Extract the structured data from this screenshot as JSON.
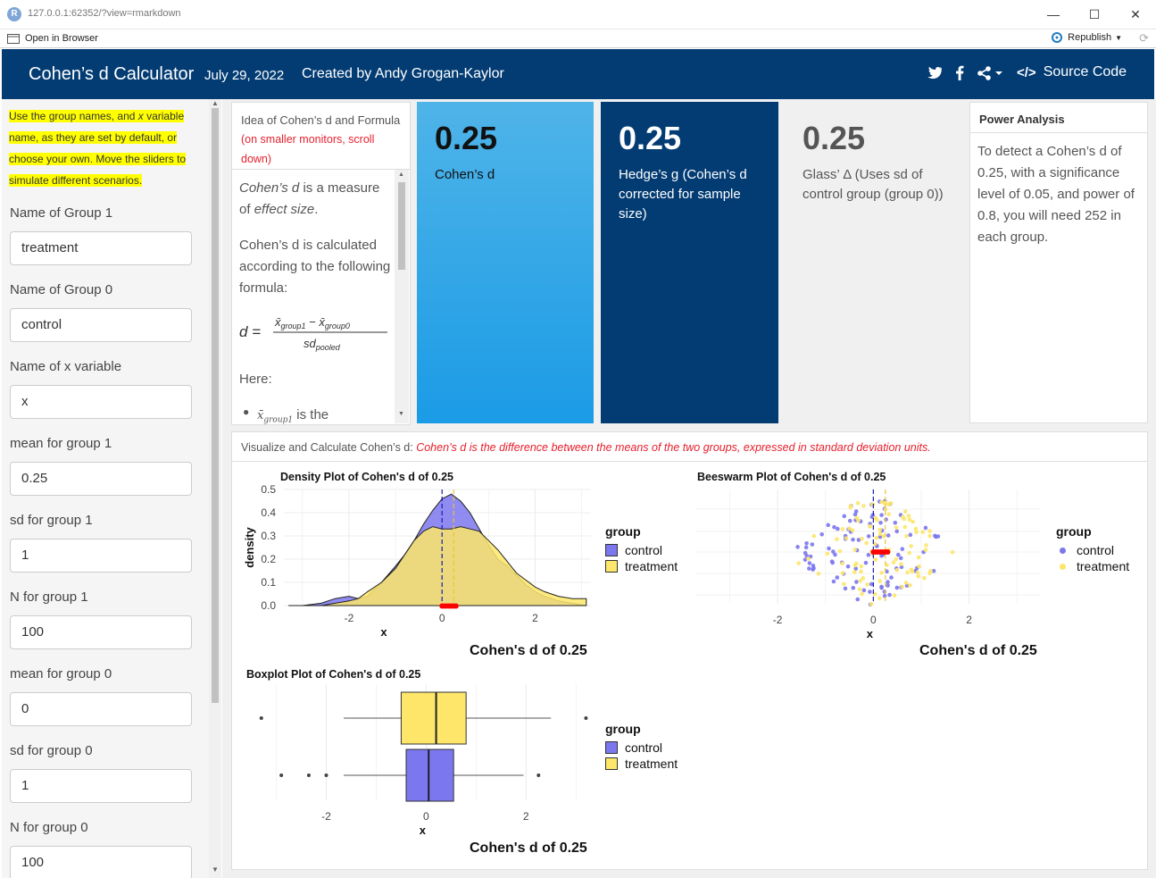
{
  "window": {
    "url": "127.0.0.1:62352/?view=rmarkdown",
    "open_in_browser": "Open in Browser",
    "republish": "Republish"
  },
  "navbar": {
    "title": "Cohen’s d Calculator",
    "date": "July 29, 2022",
    "author": "Created by Andy Grogan-Kaylor",
    "source_code": "Source Code"
  },
  "sidebar": {
    "note_parts": [
      "Use the group names, and ",
      "x",
      " variable name, as they are set by default, or choose your own. Move the sliders to simulate different scenarios."
    ],
    "fields": [
      {
        "label": "Name of Group 1",
        "value": "treatment"
      },
      {
        "label": "Name of Group 0",
        "value": "control"
      },
      {
        "label": "Name of x variable",
        "value": "x"
      },
      {
        "label": "mean for group 1",
        "value": "0.25"
      },
      {
        "label": "sd for group 1",
        "value": "1"
      },
      {
        "label": "N for group 1",
        "value": "100"
      },
      {
        "label": "mean for group 0",
        "value": "0"
      },
      {
        "label": "sd for group 0",
        "value": "1"
      },
      {
        "label": "N for group 0",
        "value": "100"
      }
    ]
  },
  "idea": {
    "header": "Idea of Cohen’s d and Formula",
    "header_note": "(on smaller monitors, scroll down)",
    "p1_em1": "Cohen’s d",
    "p1_mid": " is a measure of ",
    "p1_em2": "effect size",
    "p1_end": ".",
    "p2": "Cohen’s d is calculated according to the following formula:",
    "here": "Here:",
    "bullet_suffix": "is the"
  },
  "value_boxes": [
    {
      "value": "0.25",
      "label": "Cohen’s d"
    },
    {
      "value": "0.25",
      "label": "Hedge’s g (Cohen’s d corrected for sample size)"
    },
    {
      "value": "0.25",
      "label": "Glass’ Δ (Uses sd of control group (group 0))"
    }
  ],
  "power": {
    "title": "Power Analysis",
    "text": "To detect a Cohen’s d of 0.25, with a significance level of 0.05, and power of 0.8, you will need 252 in each group."
  },
  "visualize": {
    "header": "Visualize and Calculate Cohen’s d: ",
    "header_note": "Cohen’s d is the difference between the means of the two groups, expressed in standard deviation units."
  },
  "colors": {
    "control": "#7b77ee",
    "treatment": "#fde66a",
    "mean_marker": "#ff0000",
    "navbar": "#033c73"
  },
  "chart_data": [
    {
      "type": "area",
      "title": "Density Plot of Cohen's d of 0.25",
      "subtitle": "Cohen's d of 0.25",
      "xlabel": "x",
      "ylabel": "density",
      "xticks": [
        "-2",
        "0",
        "2"
      ],
      "yticks": [
        "0.0",
        "0.1",
        "0.2",
        "0.3",
        "0.4",
        "0.5"
      ],
      "xlim": [
        -3.4,
        3.2
      ],
      "ylim": [
        0,
        0.5
      ],
      "legend_title": "group",
      "series": [
        {
          "name": "control",
          "x": [
            -3.3,
            -3.0,
            -2.6,
            -2.3,
            -2.0,
            -1.8,
            -1.6,
            -1.3,
            -1.0,
            -0.8,
            -0.6,
            -0.4,
            -0.2,
            0.0,
            0.1,
            0.2,
            0.4,
            0.6,
            0.8,
            1.0,
            1.2,
            1.4,
            1.6,
            1.8,
            2.0,
            2.2,
            2.5,
            2.8,
            3.1
          ],
          "y": [
            0.0,
            0.0,
            0.01,
            0.03,
            0.04,
            0.03,
            0.04,
            0.1,
            0.17,
            0.22,
            0.28,
            0.35,
            0.41,
            0.46,
            0.47,
            0.48,
            0.45,
            0.4,
            0.33,
            0.26,
            0.2,
            0.17,
            0.13,
            0.09,
            0.06,
            0.04,
            0.02,
            0.01,
            0.0
          ]
        },
        {
          "name": "treatment",
          "x": [
            -3.3,
            -3.0,
            -2.6,
            -2.3,
            -2.0,
            -1.8,
            -1.6,
            -1.3,
            -1.0,
            -0.8,
            -0.6,
            -0.4,
            -0.2,
            0.0,
            0.2,
            0.4,
            0.6,
            0.8,
            1.0,
            1.2,
            1.4,
            1.6,
            1.8,
            2.0,
            2.2,
            2.5,
            2.8,
            3.1
          ],
          "y": [
            0.0,
            0.0,
            0.0,
            0.01,
            0.02,
            0.03,
            0.06,
            0.1,
            0.16,
            0.22,
            0.28,
            0.32,
            0.34,
            0.33,
            0.33,
            0.34,
            0.33,
            0.32,
            0.28,
            0.24,
            0.19,
            0.14,
            0.11,
            0.08,
            0.06,
            0.04,
            0.03,
            0.03
          ]
        }
      ],
      "vlines": [
        {
          "x": 0.0,
          "group": "control"
        },
        {
          "x": 0.25,
          "group": "treatment"
        }
      ]
    },
    {
      "type": "scatter",
      "title": "Beeswarm Plot of Cohen's d of 0.25",
      "subtitle": "Cohen's d of 0.25",
      "xlabel": "x",
      "xticks": [
        "-2",
        "0",
        "2"
      ],
      "xlim": [
        -3.7,
        3.5
      ],
      "legend_title": "group",
      "series": [
        {
          "name": "control"
        },
        {
          "name": "treatment"
        }
      ]
    },
    {
      "type": "box",
      "title": "Boxplot Plot of Cohen's d of 0.25",
      "subtitle": "Cohen's d of 0.25",
      "xlabel": "x",
      "xticks": [
        "-2",
        "0",
        "2"
      ],
      "xlim": [
        -3.6,
        3.3
      ],
      "legend_title": "group",
      "series": [
        {
          "name": "control",
          "q1": -0.4,
          "median": 0.05,
          "q3": 0.55,
          "whisker_low": -1.65,
          "whisker_high": 1.95,
          "outliers": [
            -2.9,
            -2.35,
            -2.0,
            2.25
          ]
        },
        {
          "name": "treatment",
          "q1": -0.5,
          "median": 0.2,
          "q3": 0.8,
          "whisker_low": -1.65,
          "whisker_high": 2.5,
          "outliers": [
            -3.3,
            3.2
          ]
        }
      ]
    }
  ]
}
